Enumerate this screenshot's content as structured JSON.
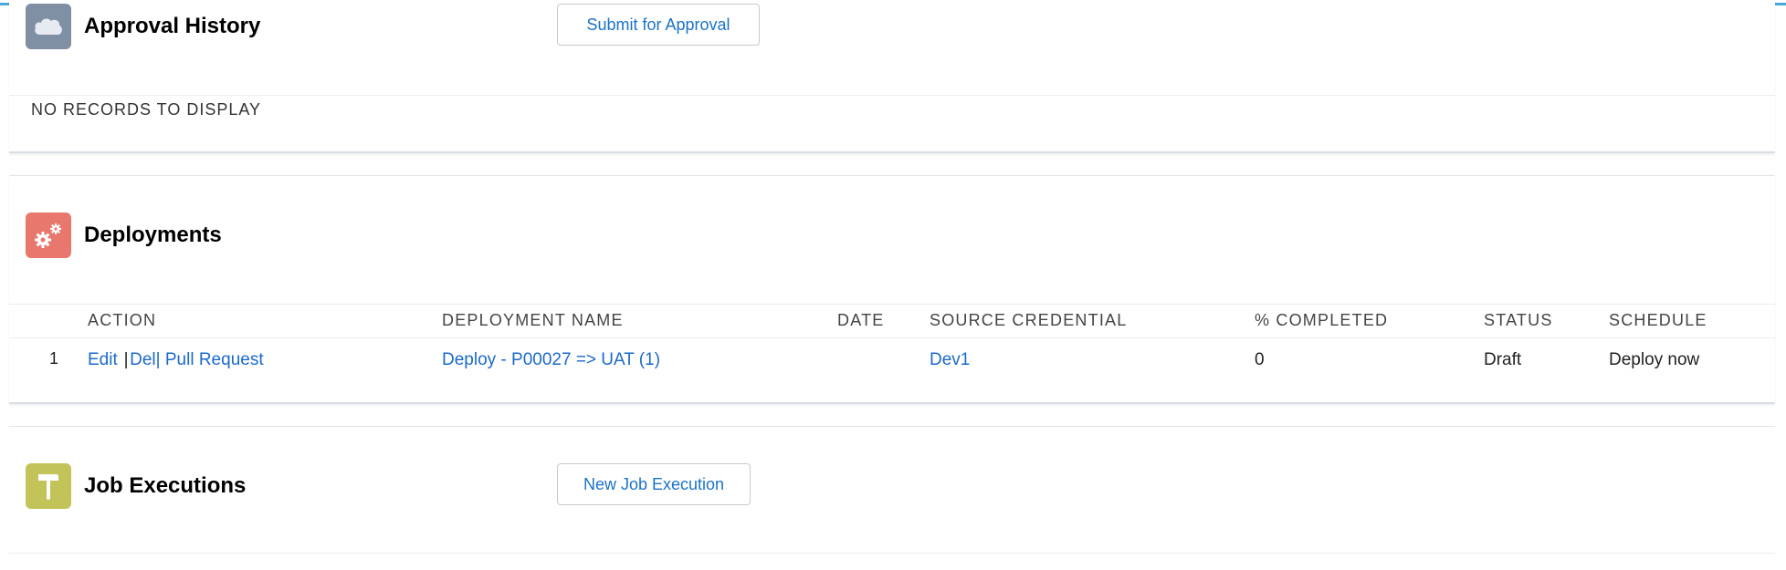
{
  "approval_history": {
    "title": "Approval History",
    "icon": "cloud-icon",
    "icon_color": "#7f8fa4",
    "submit_button": "Submit for Approval",
    "empty_message": "NO RECORDS TO DISPLAY"
  },
  "deployments": {
    "title": "Deployments",
    "icon": "gears-icon",
    "icon_color": "#e8786e",
    "columns": {
      "action": "ACTION",
      "deployment_name": "DEPLOYMENT NAME",
      "date": "DATE",
      "source_credential": "SOURCE CREDENTIAL",
      "percent_completed": "% COMPLETED",
      "status": "STATUS",
      "schedule": "SCHEDULE"
    },
    "rows": [
      {
        "number": "1",
        "edit": "Edit",
        "del": "Del",
        "pull_request": "Pull Request",
        "deployment_name": "Deploy - P00027 => UAT (1)",
        "date": "",
        "source_credential": "Dev1",
        "percent_completed": "0",
        "status": "Draft",
        "schedule": "Deploy now"
      }
    ]
  },
  "job_executions": {
    "title": "Job Executions",
    "icon": "hammer-icon",
    "icon_color": "#c2c45a",
    "new_button": "New Job Execution"
  },
  "colors": {
    "accent": "#4aa8d8",
    "link": "#1b6ac9"
  }
}
